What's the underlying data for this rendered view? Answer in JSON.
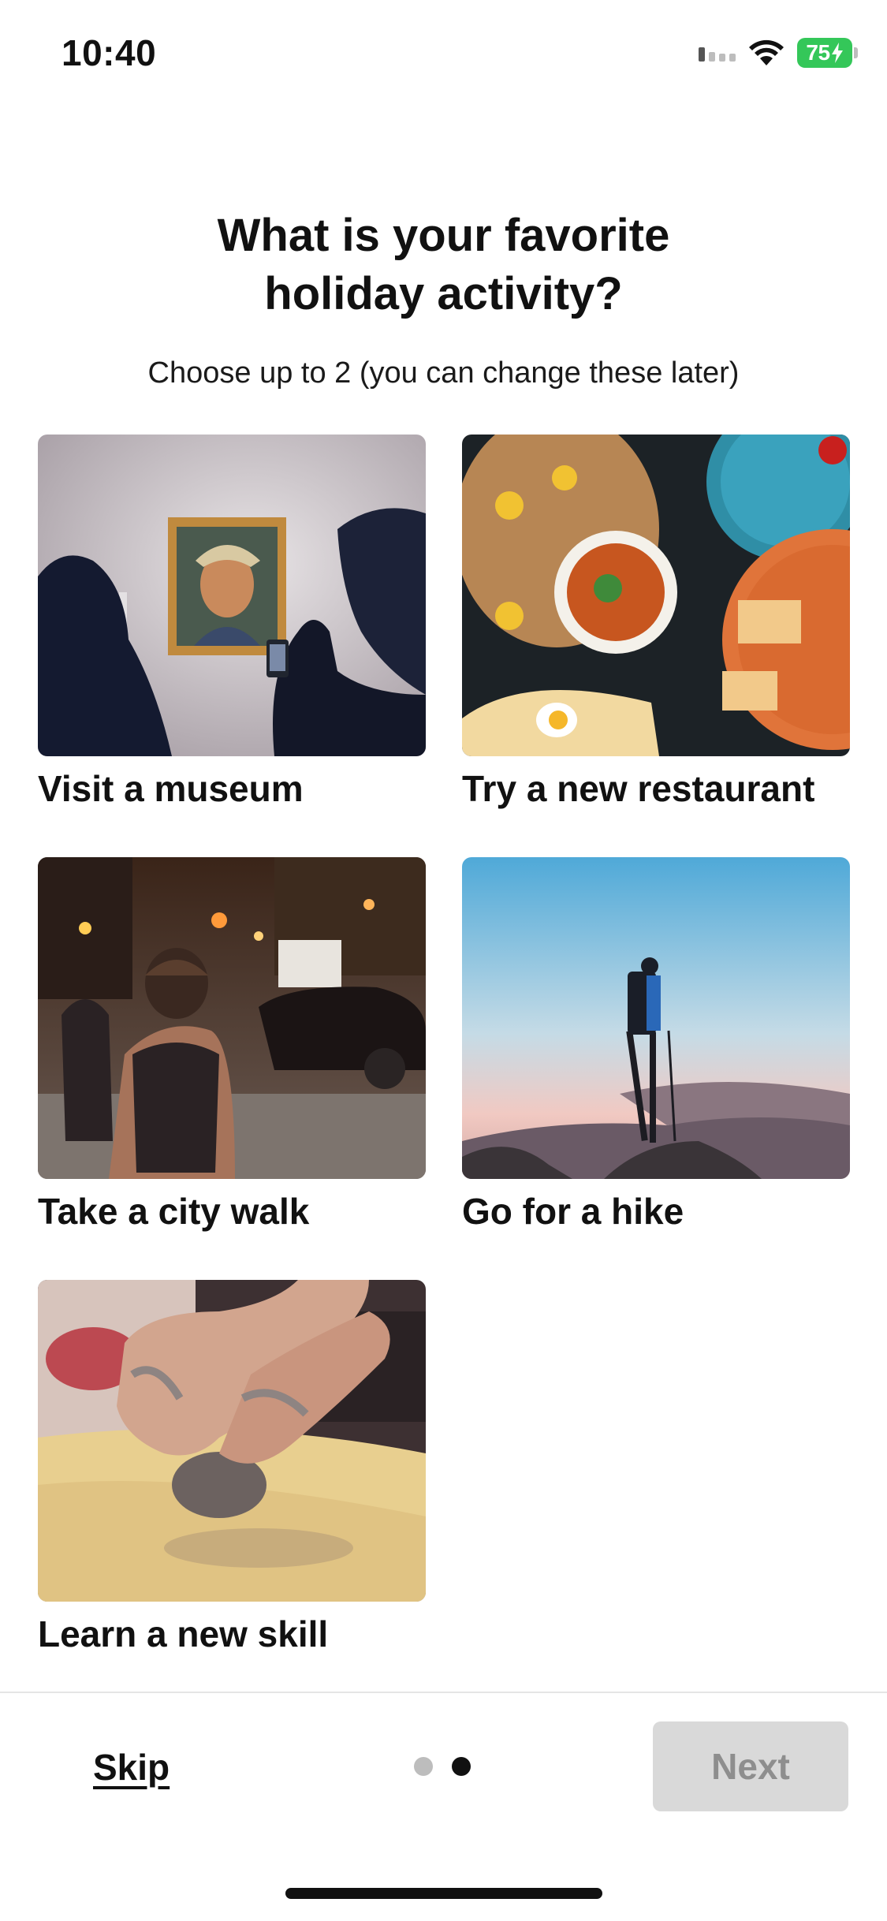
{
  "status_bar": {
    "time": "10:40",
    "battery_percent": "75",
    "battery_color": "#34c759",
    "icons": [
      "signal-icon",
      "wifi-icon",
      "battery-charging-icon"
    ]
  },
  "header": {
    "title_line1": "What is your favorite",
    "title_line2": "holiday activity?",
    "subtitle": "Choose up to 2 (you can change these later)"
  },
  "options": [
    {
      "label": "Visit a museum",
      "image": "museum-photo"
    },
    {
      "label": "Try a new restaurant",
      "image": "restaurant-food-photo"
    },
    {
      "label": "Take a city walk",
      "image": "city-walk-photo"
    },
    {
      "label": "Go for a hike",
      "image": "hike-photo"
    },
    {
      "label": "Learn a new skill",
      "image": "pottery-photo"
    }
  ],
  "footer": {
    "skip_label": "Skip",
    "next_label": "Next",
    "pagination": {
      "total": 2,
      "current": 2
    }
  }
}
